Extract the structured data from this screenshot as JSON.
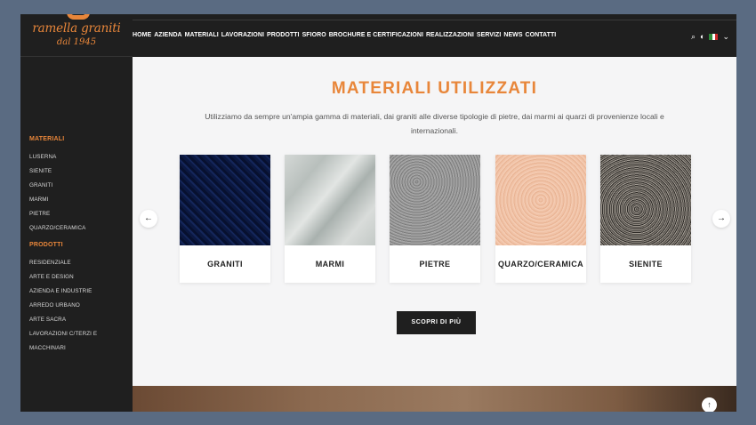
{
  "brand": {
    "name": "ramella graniti",
    "year": "dal 1945"
  },
  "nav": [
    "HOME",
    "AZIENDA",
    "MATERIALI",
    "LAVORAZIONI",
    "PRODOTTI",
    "SFIORO",
    "BROCHURE E CERTIFICAZIONI",
    "REALIZZAZIONI",
    "SERVIZI",
    "NEWS",
    "CONTATTI"
  ],
  "tools": {
    "search_icon": "⌕",
    "theme_icon": "◐",
    "chevron_icon": "⌄"
  },
  "sidebar": {
    "materiali_heading": "MATERIALI",
    "materiali": [
      "LUSERNA",
      "SIENITE",
      "GRANITI",
      "MARMI",
      "PIETRE",
      "QUARZO/CERAMICA"
    ],
    "prodotti_heading": "PRODOTTI",
    "prodotti": [
      "RESIDENZIALE",
      "ARTE E DESIGN",
      "AZIENDA E INDUSTRIE",
      "ARREDO URBANO",
      "ARTE SACRA",
      "LAVORAZIONI C/TERZI E",
      "MACCHINARI"
    ]
  },
  "main": {
    "title": "MATERIALI UTILIZZATI",
    "subtitle": "Utilizziamo da sempre un'ampia gamma di materiali, dai graniti alle diverse tipologie di pietre, dai marmi ai quarzi di provenienze locali e internazionali.",
    "cards": [
      "GRANITI",
      "MARMI",
      "PIETRE",
      "QUARZO/CERAMICA",
      "SIENITE"
    ],
    "prev_icon": "←",
    "next_icon": "→",
    "cta": "SCOPRI DI PIÙ",
    "to_top_icon": "↑"
  },
  "colors": {
    "accent": "#e8863a",
    "dark": "#1f1f1f",
    "flag_green": "#2e8b3a",
    "flag_white": "#ffffff",
    "flag_red": "#cc2b2b"
  }
}
